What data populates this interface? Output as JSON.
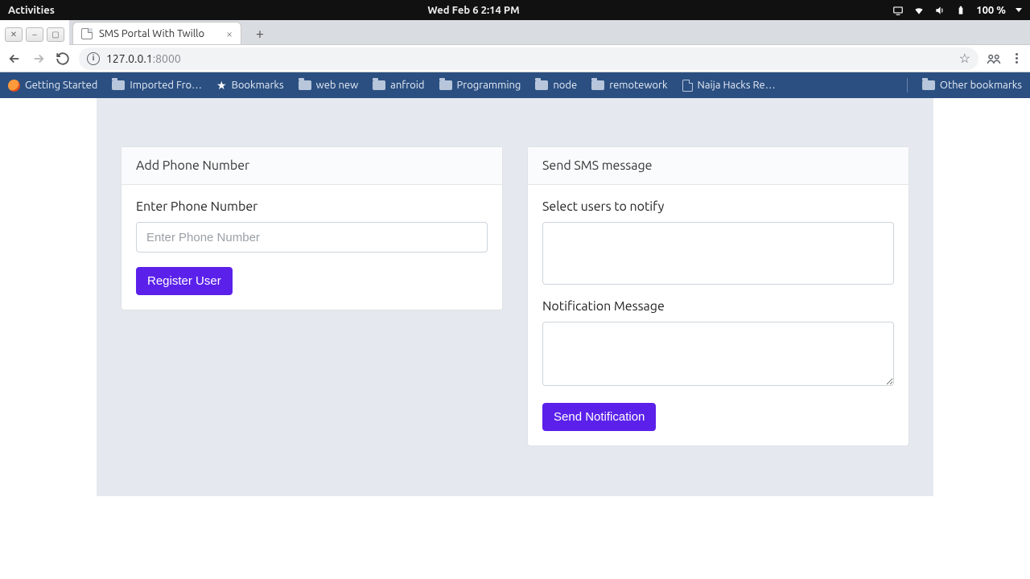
{
  "system": {
    "activities": "Activities",
    "clock": "Wed Feb 6   2:14 PM",
    "battery": "100 %"
  },
  "browser": {
    "tab_title": "SMS Portal With Twillo",
    "url_host": "127.0.0.1",
    "url_path": ":8000",
    "bookmarks": [
      {
        "icon": "ff",
        "label": "Getting Started"
      },
      {
        "icon": "folder",
        "label": "Imported Fro…"
      },
      {
        "icon": "star",
        "label": "Bookmarks"
      },
      {
        "icon": "folder",
        "label": "web new"
      },
      {
        "icon": "folder",
        "label": "anfroid"
      },
      {
        "icon": "folder",
        "label": "Programming"
      },
      {
        "icon": "folder",
        "label": "node"
      },
      {
        "icon": "folder",
        "label": "remotework"
      },
      {
        "icon": "page",
        "label": "Naija Hacks Re…"
      }
    ],
    "other_bookmarks": "Other bookmarks"
  },
  "page": {
    "left": {
      "title": "Add Phone Number",
      "phone_label": "Enter Phone Number",
      "phone_placeholder": "Enter Phone Number",
      "submit": "Register User"
    },
    "right": {
      "title": "Send SMS message",
      "users_label": "Select users to notify",
      "message_label": "Notification Message",
      "submit": "Send Notification"
    }
  }
}
